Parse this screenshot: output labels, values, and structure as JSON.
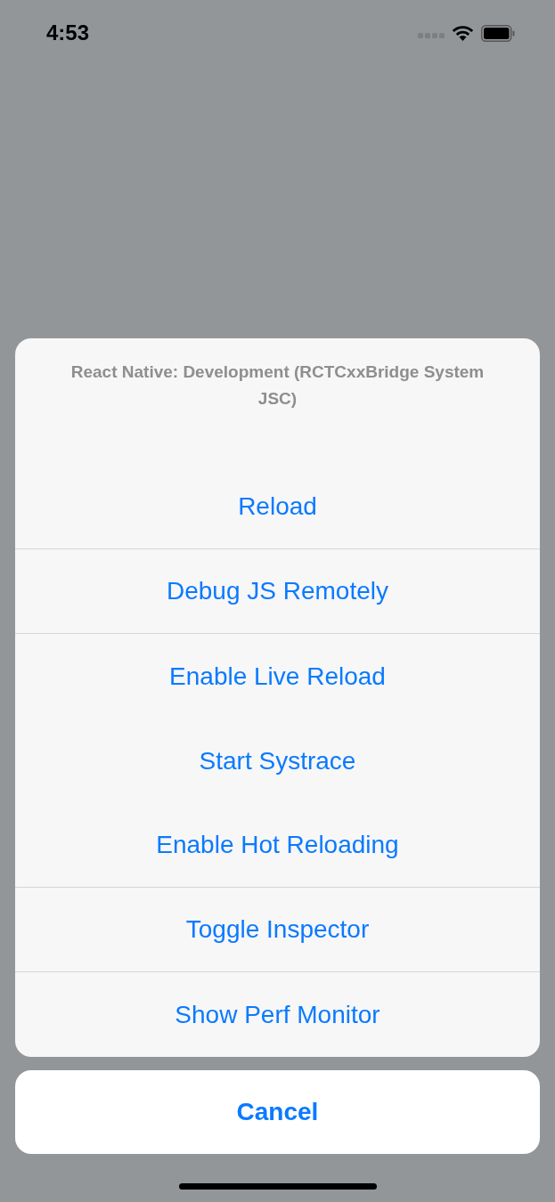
{
  "status_bar": {
    "time": "4:53"
  },
  "action_sheet": {
    "title": "React Native: Development (RCTCxxBridge System JSC)",
    "actions": [
      {
        "label": "Reload",
        "separator_below": true
      },
      {
        "label": "Debug JS Remotely",
        "separator_below": true
      },
      {
        "label": "Enable Live Reload",
        "separator_below": false
      },
      {
        "label": "Start Systrace",
        "separator_below": false
      },
      {
        "label": "Enable Hot Reloading",
        "separator_below": true
      },
      {
        "label": "Toggle Inspector",
        "separator_below": true
      },
      {
        "label": "Show Perf Monitor",
        "separator_below": false
      }
    ],
    "cancel": "Cancel"
  }
}
